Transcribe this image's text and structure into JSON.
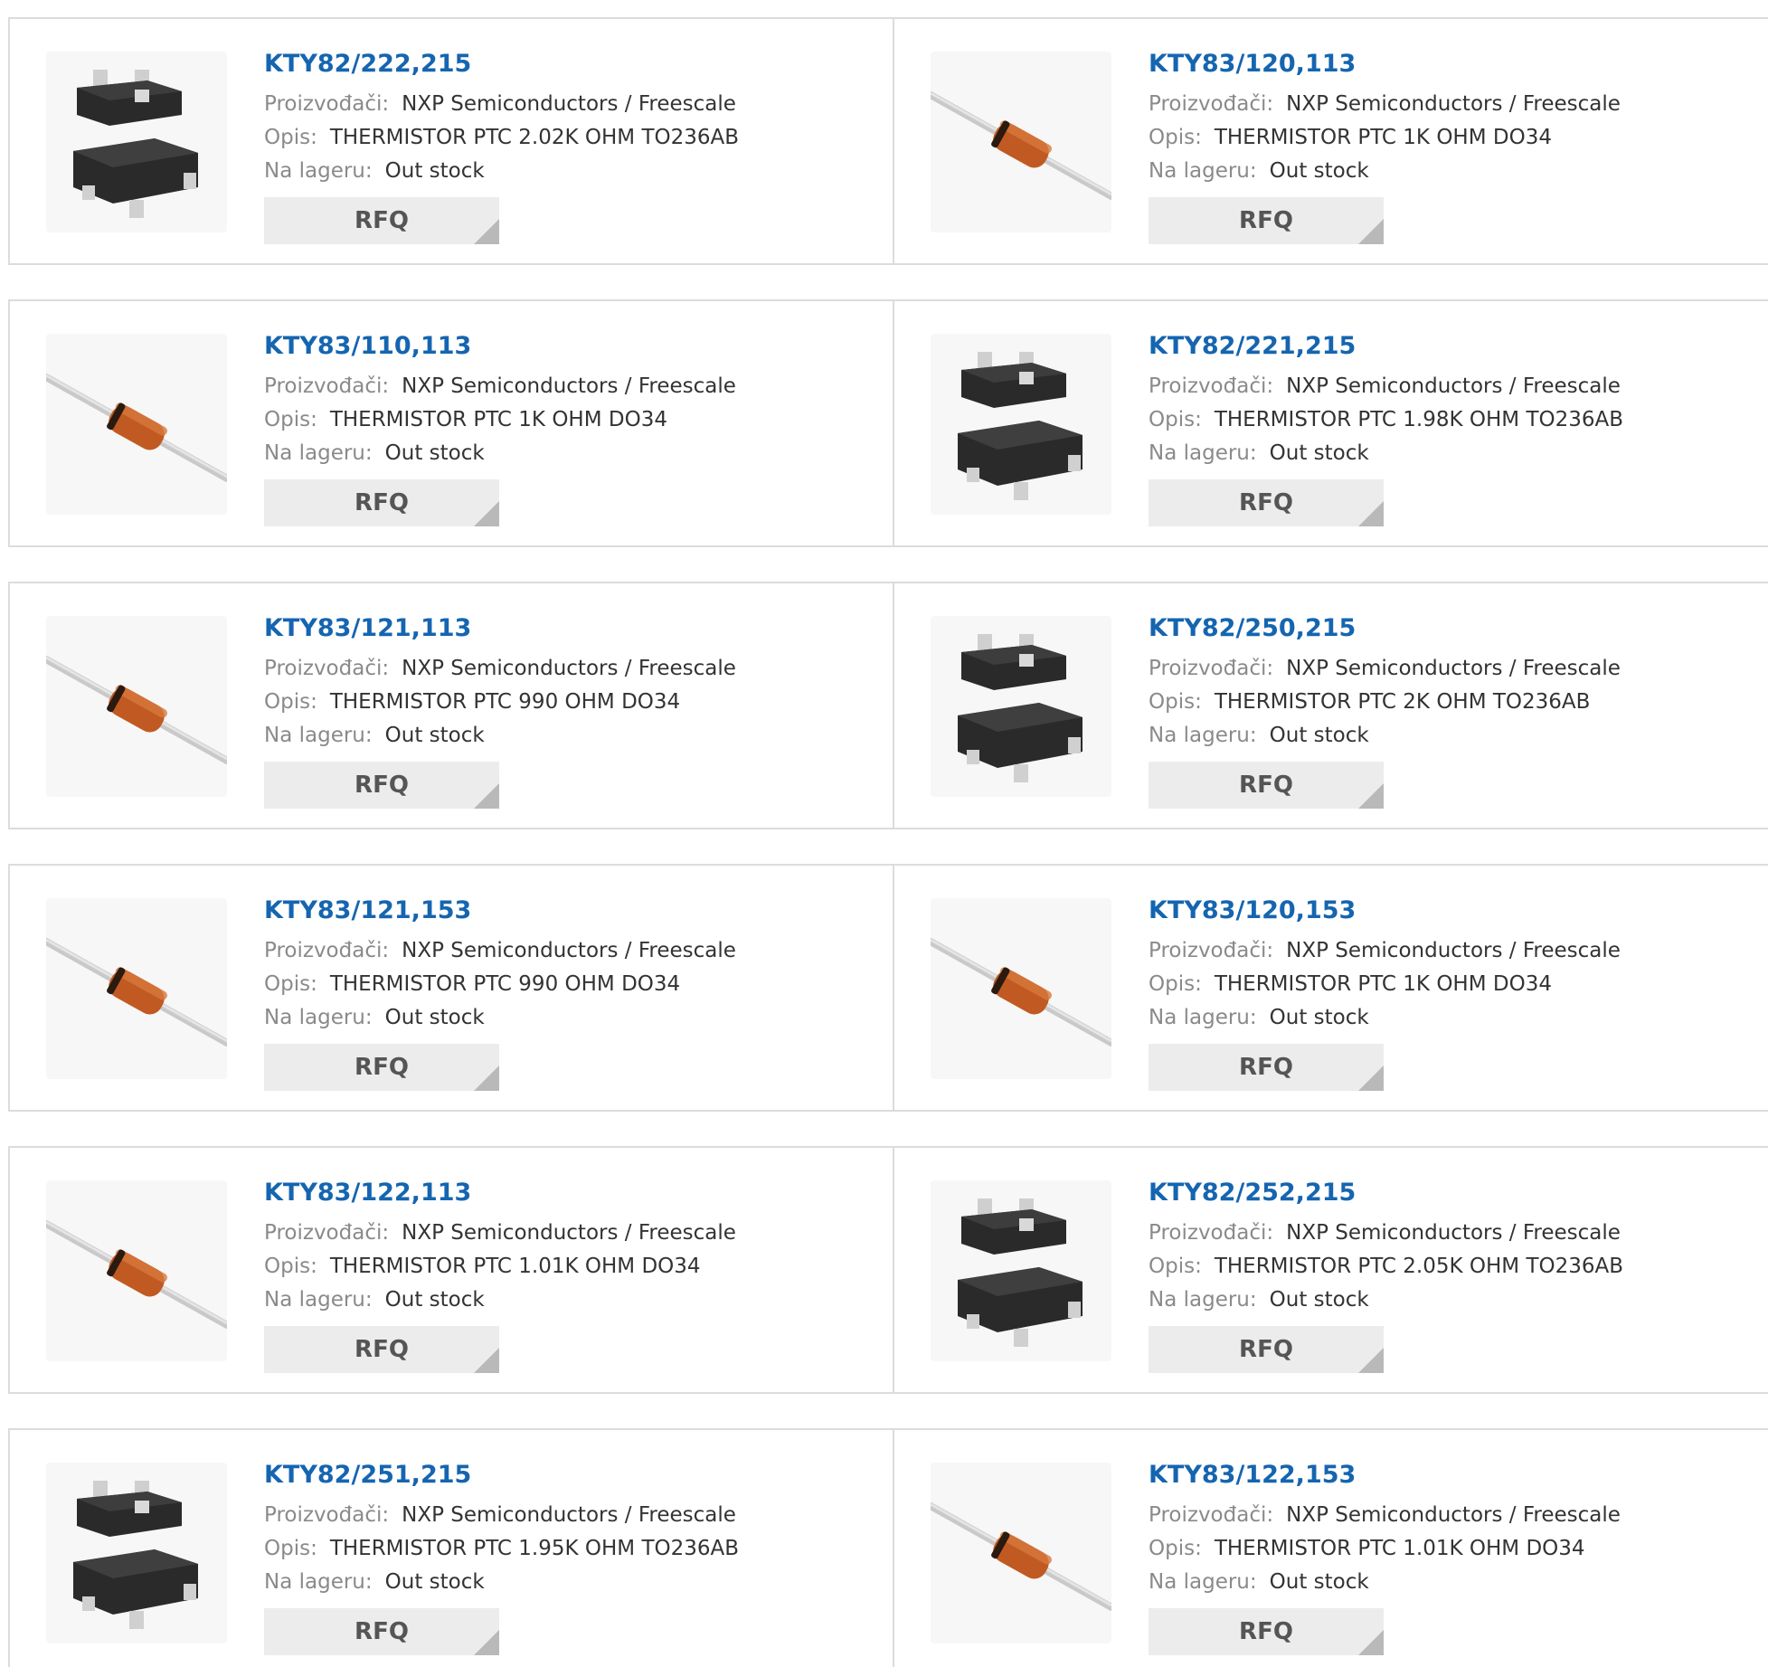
{
  "labels": {
    "manufacturer": "Proizvođači:",
    "description": "Opis:",
    "stock": "Na lageru:",
    "rfq": "RFQ"
  },
  "colors": {
    "part_number": "#1565b0",
    "label": "#8a8a8a",
    "value": "#333333",
    "rfq_bg": "#ececec"
  },
  "products": [
    {
      "part": "KTY82/222,215",
      "manufacturer": "NXP Semiconductors / Freescale",
      "description": "THERMISTOR PTC 2.02K OHM TO236AB",
      "stock": "Out stock",
      "package_icon": "sot23-chip-icon"
    },
    {
      "part": "KTY83/120,113",
      "manufacturer": "NXP Semiconductors / Freescale",
      "description": "THERMISTOR PTC 1K OHM DO34",
      "stock": "Out stock",
      "package_icon": "axial-diode-icon"
    },
    {
      "part": "KTY83/110,113",
      "manufacturer": "NXP Semiconductors / Freescale",
      "description": "THERMISTOR PTC 1K OHM DO34",
      "stock": "Out stock",
      "package_icon": "axial-diode-icon"
    },
    {
      "part": "KTY82/221,215",
      "manufacturer": "NXP Semiconductors / Freescale",
      "description": "THERMISTOR PTC 1.98K OHM TO236AB",
      "stock": "Out stock",
      "package_icon": "sot23-chip-icon"
    },
    {
      "part": "KTY83/121,113",
      "manufacturer": "NXP Semiconductors / Freescale",
      "description": "THERMISTOR PTC 990 OHM DO34",
      "stock": "Out stock",
      "package_icon": "axial-diode-icon"
    },
    {
      "part": "KTY82/250,215",
      "manufacturer": "NXP Semiconductors / Freescale",
      "description": "THERMISTOR PTC 2K OHM TO236AB",
      "stock": "Out stock",
      "package_icon": "sot23-chip-icon"
    },
    {
      "part": "KTY83/121,153",
      "manufacturer": "NXP Semiconductors / Freescale",
      "description": "THERMISTOR PTC 990 OHM DO34",
      "stock": "Out stock",
      "package_icon": "axial-diode-icon"
    },
    {
      "part": "KTY83/120,153",
      "manufacturer": "NXP Semiconductors / Freescale",
      "description": "THERMISTOR PTC 1K OHM DO34",
      "stock": "Out stock",
      "package_icon": "axial-diode-icon"
    },
    {
      "part": "KTY83/122,113",
      "manufacturer": "NXP Semiconductors / Freescale",
      "description": "THERMISTOR PTC 1.01K OHM DO34",
      "stock": "Out stock",
      "package_icon": "axial-diode-icon"
    },
    {
      "part": "KTY82/252,215",
      "manufacturer": "NXP Semiconductors / Freescale",
      "description": "THERMISTOR PTC 2.05K OHM TO236AB",
      "stock": "Out stock",
      "package_icon": "sot23-chip-icon"
    },
    {
      "part": "KTY82/251,215",
      "manufacturer": "NXP Semiconductors / Freescale",
      "description": "THERMISTOR PTC 1.95K OHM TO236AB",
      "stock": "Out stock",
      "package_icon": "sot23-chip-icon"
    },
    {
      "part": "KTY83/122,153",
      "manufacturer": "NXP Semiconductors / Freescale",
      "description": "THERMISTOR PTC 1.01K OHM DO34",
      "stock": "Out stock",
      "package_icon": "axial-diode-icon"
    }
  ]
}
